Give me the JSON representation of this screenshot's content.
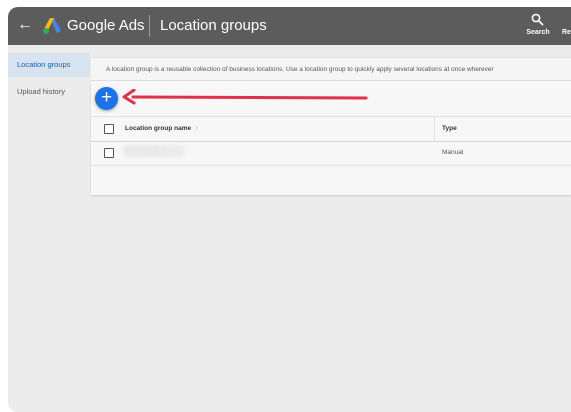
{
  "header": {
    "brand": "Google Ads",
    "page_title": "Location groups",
    "search_label": "Search",
    "reports_label": "Re"
  },
  "sidebar": {
    "items": [
      {
        "label": "Location groups",
        "active": true
      },
      {
        "label": "Upload history",
        "active": false
      }
    ]
  },
  "main": {
    "description": "A location group is a reusable collection of business locations. Use a location group to quickly apply several locations at once wherever",
    "add_button_symbol": "+",
    "table": {
      "columns": [
        {
          "label": "Location group name",
          "sort_icon": "↑"
        },
        {
          "label": "Type"
        }
      ],
      "rows": [
        {
          "name": "",
          "type": "Manual"
        }
      ]
    }
  },
  "colors": {
    "topbar": "#5c5c5c",
    "accent_blue": "#1a73e8",
    "annotation_red": "#e0314b",
    "sidebar_active": "#d8e3f0"
  },
  "icons": [
    "back-arrow-icon",
    "google-ads-logo-icon",
    "search-icon",
    "add-icon",
    "sort-ascending-icon",
    "annotation-arrow-icon",
    "checkbox-icon"
  ]
}
